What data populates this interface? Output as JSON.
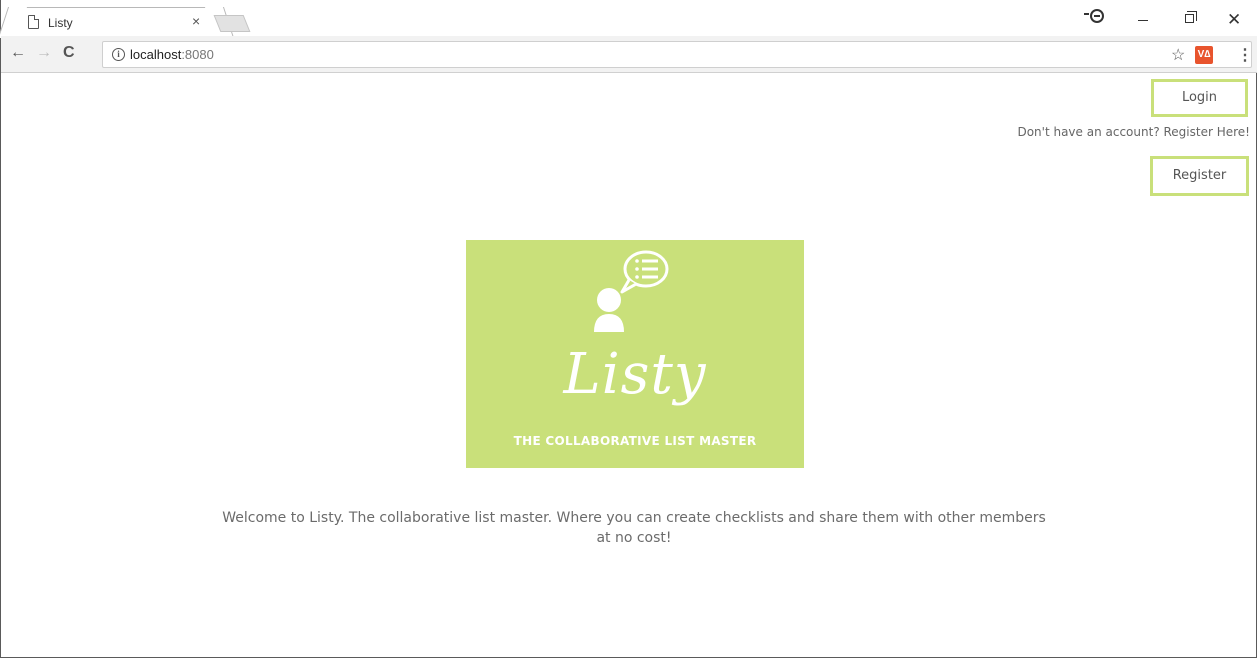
{
  "browser": {
    "tab_title": "Listy",
    "tab_close": "×",
    "url_host": "localhost",
    "url_port": ":8080",
    "back_glyph": "←",
    "forward_glyph": "→",
    "reload_glyph": "C",
    "info_glyph": "i",
    "star_glyph": "☆",
    "extension_label": "V∆",
    "menu_glyph": "⋮",
    "close_glyph": "✕",
    "icons": [
      "page-icon",
      "close-icon",
      "profile-icon",
      "minimize-icon",
      "restore-icon",
      "back-icon",
      "forward-icon",
      "reload-icon",
      "info-icon",
      "star-icon",
      "extension-icon",
      "menu-icon"
    ]
  },
  "header": {
    "login_label": "Login",
    "no_account_text": "Don't have an account? Register Here!",
    "register_label": "Register"
  },
  "logo": {
    "wordmark": "Listy",
    "tagline": "THE COLLABORATIVE LIST MASTER",
    "background_color": "#c9e07a",
    "icon": "user-speech-bubble-list-icon"
  },
  "main": {
    "welcome_text": "Welcome to Listy. The collaborative list master. Where you can create checklists and share them with other members at no cost!"
  },
  "colors": {
    "accent": "#c9e07a",
    "text": "#6b6b6b"
  }
}
